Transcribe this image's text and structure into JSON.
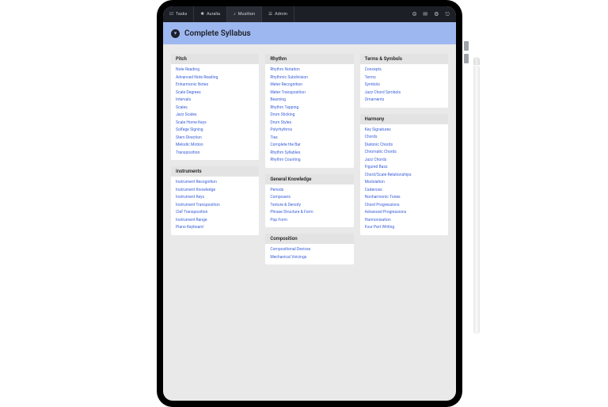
{
  "topbar": {
    "tabs": [
      {
        "label": "Tasks"
      },
      {
        "label": "Auralia"
      },
      {
        "label": "Musition"
      },
      {
        "label": "Admin"
      }
    ]
  },
  "header": {
    "title": "Complete Syllabus"
  },
  "columns": [
    [
      {
        "title": "Pitch",
        "items": [
          "Note Reading",
          "Advanced Note Reading",
          "Enharmonic Notes",
          "Scale Degrees",
          "Intervals",
          "Scales",
          "Jazz Scales",
          "Scale Home Keys",
          "Solfege Signing",
          "Stem Direction",
          "Melodic Motion",
          "Transposition"
        ]
      },
      {
        "title": "Instruments",
        "items": [
          "Instrument Recognition",
          "Instrument Knowledge",
          "Instrument Keys",
          "Instrument Transposition",
          "Clef Transposition",
          "Instrument Range",
          "Piano Keyboard"
        ]
      }
    ],
    [
      {
        "title": "Rhythm",
        "items": [
          "Rhythm Notation",
          "Rhythmic Subdivision",
          "Meter Recognition",
          "Meter Transposition",
          "Beaming",
          "Rhythm Tapping",
          "Drum Sticking",
          "Drum Styles",
          "Polyrhythms",
          "Ties",
          "Complete the Bar",
          "Rhythm Syllables",
          "Rhythm Counting"
        ]
      },
      {
        "title": "General Knowledge",
        "items": [
          "Periods",
          "Composers",
          "Texture & Density",
          "Phrase Structure & Form",
          "Pop Form"
        ]
      },
      {
        "title": "Composition",
        "items": [
          "Compositional Devices",
          "Mechanical Voicings"
        ]
      }
    ],
    [
      {
        "title": "Terms & Symbols",
        "items": [
          "Concepts",
          "Terms",
          "Symbols",
          "Jazz Chord Symbols",
          "Ornaments"
        ]
      },
      {
        "title": "Harmony",
        "items": [
          "Key Signatures",
          "Chords",
          "Diatonic Chords",
          "Chromatic Chords",
          "Jazz Chords",
          "Figured Bass",
          "Chord/Scale Relationships",
          "Modulation",
          "Cadences",
          "Nonharmonic Tones",
          "Chord Progressions",
          "Advanced Progressions",
          "Harmonisation",
          "Four Part Writing"
        ]
      }
    ]
  ]
}
